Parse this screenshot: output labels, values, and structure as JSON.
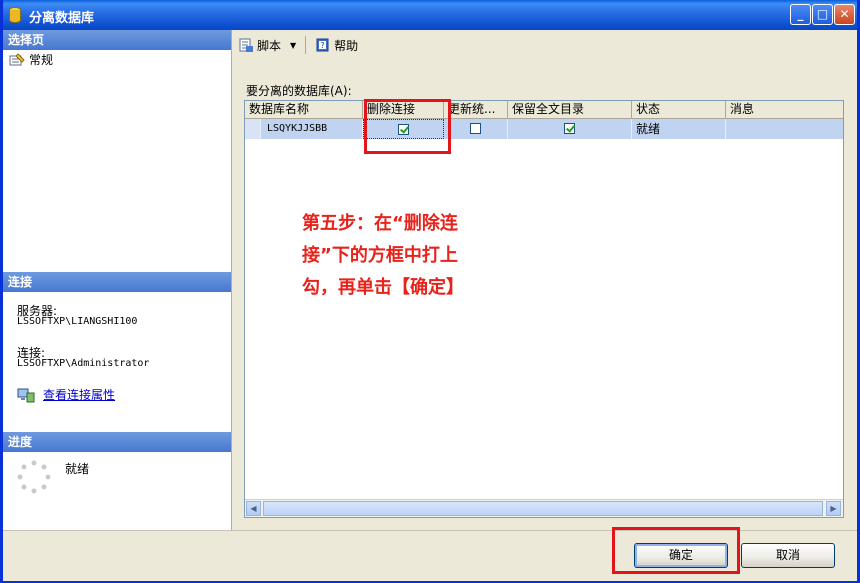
{
  "window": {
    "title": "分离数据库"
  },
  "left": {
    "select_page_header": "选择页",
    "pages": [
      {
        "label": "常规"
      }
    ],
    "connection_header": "连接",
    "server_label": "服务器:",
    "server_value": "LSSOFTXP\\LIANGSHI100",
    "connection_label": "连接:",
    "connection_value": "LSSOFTXP\\Administrator",
    "view_connection_link": "查看连接属性",
    "progress_header": "进度",
    "progress_status": "就绪"
  },
  "toolbar": {
    "script_label": "脚本",
    "help_label": "帮助"
  },
  "grid": {
    "section_label": "要分离的数据库(A):",
    "columns": [
      "数据库名称",
      "删除连接",
      "更新统...",
      "保留全文目录",
      "状态",
      "消息"
    ],
    "rows": [
      {
        "name": "LSQYKJJSBB",
        "drop_connections": true,
        "update_stats": false,
        "keep_fulltext": true,
        "status": "就绪",
        "message": ""
      }
    ]
  },
  "annotation": {
    "line1": "第五步：在“删除连",
    "line2": "接”下的方框中打上",
    "line3": "勾，再单击【确定】"
  },
  "buttons": {
    "ok_label": "确定",
    "cancel_label": "取消"
  },
  "colors": {
    "accent": "#0a46c0",
    "annotation": "#e8231c",
    "selection": "#c0d3f0"
  }
}
